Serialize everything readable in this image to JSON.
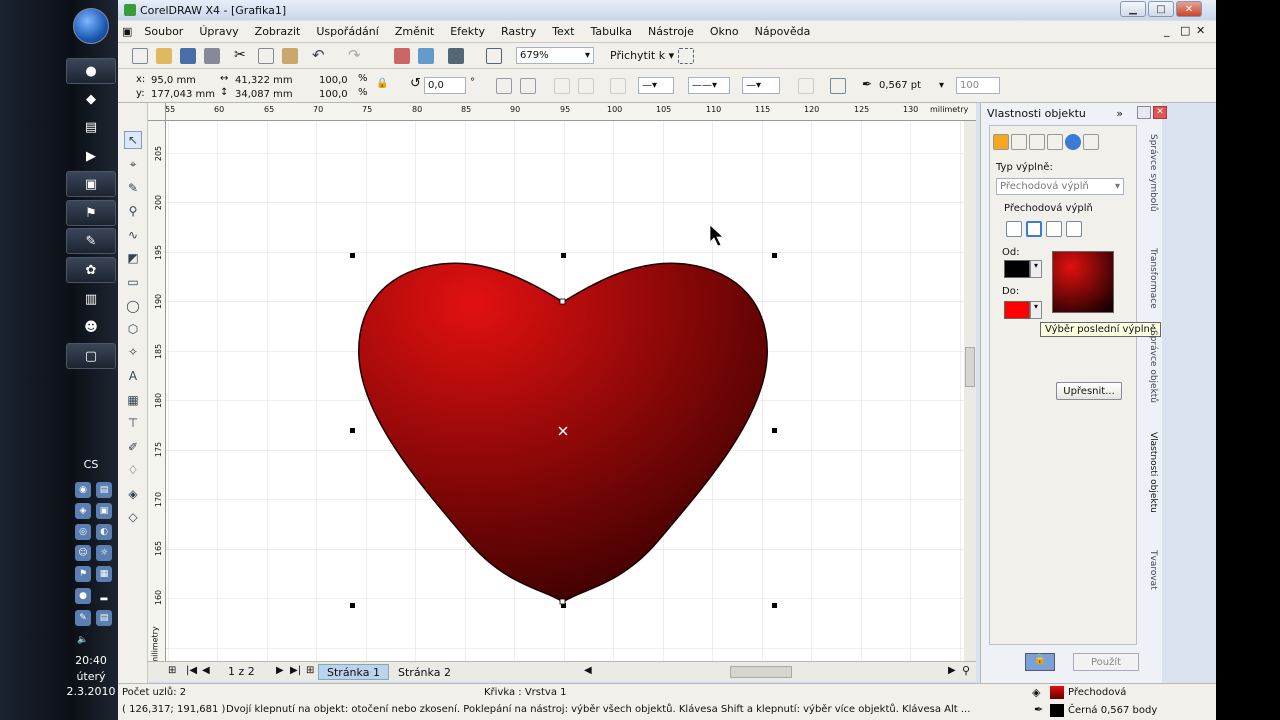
{
  "taskbar": {
    "lang": "CS",
    "time": "20:40",
    "day": "úterý",
    "date": "2.3.2010"
  },
  "window": {
    "title": "CorelDRAW X4 - [Grafika1]",
    "min_label": "▁",
    "max_label": "□",
    "close_label": "✕",
    "inner_min_label": "_",
    "inner_max_label": "□",
    "inner_close_label": "✕"
  },
  "menu": [
    "Soubor",
    "Úpravy",
    "Zobrazit",
    "Uspořádání",
    "Změnit",
    "Efekty",
    "Rastry",
    "Text",
    "Tabulka",
    "Nástroje",
    "Okno",
    "Nápověda"
  ],
  "toolbar": {
    "zoom": "679%",
    "snap_label": "Přichytit k"
  },
  "propbar": {
    "x_label": "x:",
    "x_value": "95,0 mm",
    "y_label": "y:",
    "y_value": "177,043 mm",
    "w_value": "41,322 mm",
    "h_value": "34,087 mm",
    "scale_w": "100,0",
    "scale_h": "100,0",
    "pct1": "%",
    "pct2": "%",
    "angle": "0,0",
    "degree": "°",
    "outline_width": "0,567 pt",
    "smooth": "100"
  },
  "ruler": {
    "h_ticks": [
      "55",
      "60",
      "65",
      "70",
      "75",
      "80",
      "85",
      "90",
      "95",
      "100",
      "105",
      "110",
      "115",
      "120",
      "125",
      "130"
    ],
    "unit": "milimetry",
    "v_ticks": [
      "205",
      "200",
      "195",
      "190",
      "185",
      "180",
      "175",
      "170",
      "165",
      "160"
    ],
    "v_unit": "milimetry"
  },
  "pages": {
    "counter": "1 z 2",
    "tab1": "Stránka 1",
    "tab2": "Stránka 2"
  },
  "docker": {
    "title": "Vlastnosti objektu",
    "fill_type_label": "Typ výplně:",
    "fill_type_value": "Přechodová výplň",
    "group_label": "Přechodová výplň",
    "from_label": "Od:",
    "to_label": "Do:",
    "tooltip": "Výběr poslední výplně",
    "refine_button": "Upřesnit...",
    "apply_button": "Použít",
    "side_tabs": [
      "Správce symbolů",
      "Transformace",
      "Správce objektů",
      "Vlastnosti objektu",
      "Tvarovat"
    ],
    "from_color": "#000000",
    "to_color": "#ff0000"
  },
  "status": {
    "nodes": "Počet uzlů: 2",
    "layer": "Křivka : Vrstva 1",
    "coords": "( 126,317; 191,681 )",
    "hint": "Dvojí klepnutí na objekt: otočení nebo zkosení. Poklepání na nástroj: výběr všech objektů. Klávesa Shift a klepnutí: výběr více objektů. Klávesa Alt ...",
    "fill_text": "Přechodová",
    "outline_text": "Černá  0,567 body"
  },
  "colors": {
    "heart_light": "#e21010",
    "heart_dark": "#3a0000"
  }
}
